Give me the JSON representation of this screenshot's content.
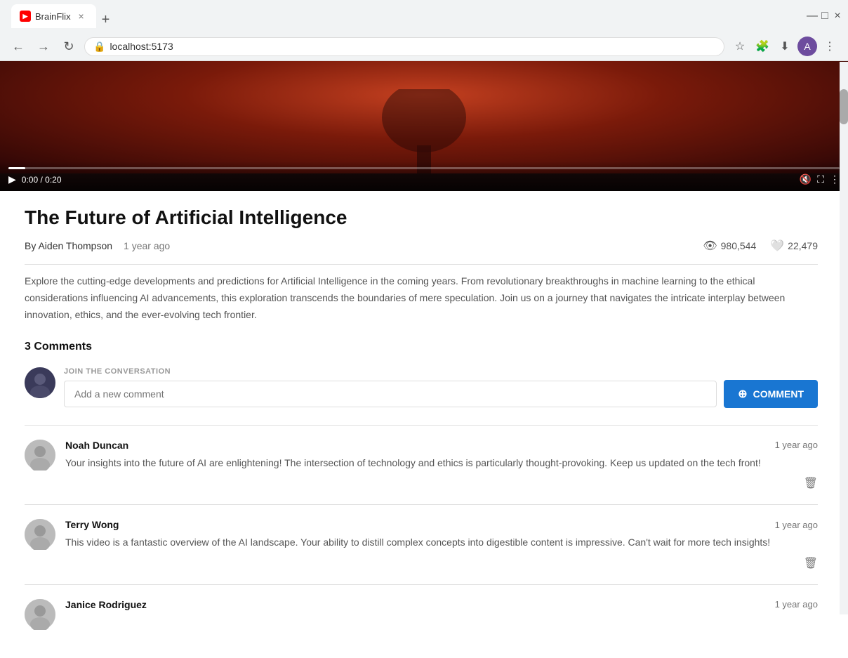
{
  "browser": {
    "tab_favicon": "▶",
    "tab_title": "BrainFlix",
    "tab_close": "×",
    "new_tab": "+",
    "nav_back": "←",
    "nav_forward": "→",
    "nav_refresh": "↻",
    "url": "localhost:5173",
    "minimize": "—",
    "maximize": "□",
    "close": "×",
    "toolbar": {
      "star": "☆",
      "extensions": "🧩",
      "download": "⬇",
      "profile": "👤",
      "menu": "⋮"
    }
  },
  "video": {
    "time_current": "0:00",
    "time_total": "0:20",
    "controls": {
      "play": "▶",
      "mute": "🔇",
      "fullscreen": "⛶",
      "more": "⋮"
    }
  },
  "page": {
    "title": "The Future of Artificial Intelligence",
    "author": "By Aiden Thompson",
    "time_ago": "1 year ago",
    "views": "980,544",
    "likes": "22,479",
    "description": "Explore the cutting-edge developments and predictions for Artificial Intelligence in the coming years. From revolutionary breakthroughs in machine learning to the ethical considerations influencing AI advancements, this exploration transcends the boundaries of mere speculation. Join us on a journey that navigates the intricate interplay between innovation, ethics, and the ever-evolving tech frontier.",
    "comments_count": "3 Comments",
    "join_label": "JOIN THE CONVERSATION",
    "comment_placeholder": "Add a new comment",
    "comment_btn": "COMMENT"
  },
  "comments": [
    {
      "name": "Noah Duncan",
      "time": "1 year ago",
      "text": "Your insights into the future of AI are enlightening! The intersection of technology and ethics is particularly thought-provoking. Keep us updated on the tech front!"
    },
    {
      "name": "Terry Wong",
      "time": "1 year ago",
      "text": "This video is a fantastic overview of the AI landscape. Your ability to distill complex concepts into digestible content is impressive. Can't wait for more tech insights!"
    },
    {
      "name": "Janice Rodriguez",
      "time": "1 year ago",
      "text": ""
    }
  ]
}
